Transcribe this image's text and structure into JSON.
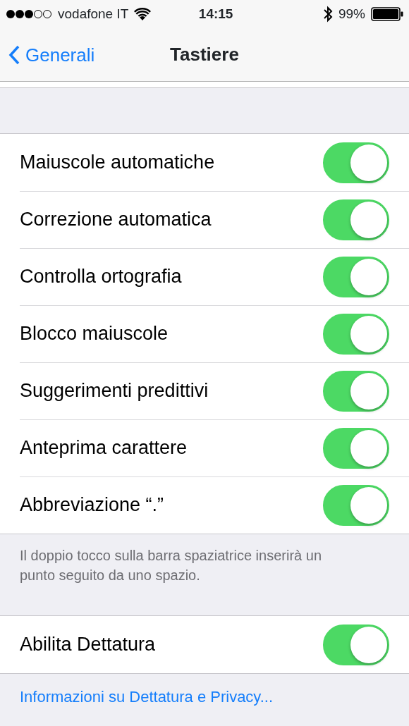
{
  "status_bar": {
    "carrier": "vodafone IT",
    "time": "14:15",
    "battery": "99%"
  },
  "nav": {
    "back": "Generali",
    "title": "Tastiere"
  },
  "groups": [
    {
      "rows": [
        {
          "label": "Maiuscole automatiche",
          "on": true
        },
        {
          "label": "Correzione automatica",
          "on": true
        },
        {
          "label": "Controlla ortografia",
          "on": true
        },
        {
          "label": "Blocco maiuscole",
          "on": true
        },
        {
          "label": "Suggerimenti predittivi",
          "on": true
        },
        {
          "label": "Anteprima carattere",
          "on": true
        },
        {
          "label": "Abbreviazione “.”",
          "on": true
        }
      ],
      "footer": {
        "kind": "note",
        "text": "Il doppio tocco sulla barra spaziatrice inserirà un punto seguito da uno spazio."
      }
    },
    {
      "rows": [
        {
          "label": "Abilita Dettatura",
          "on": true
        }
      ],
      "footer": {
        "kind": "link",
        "text": "Informazioni su Dettatura e Privacy..."
      }
    }
  ]
}
